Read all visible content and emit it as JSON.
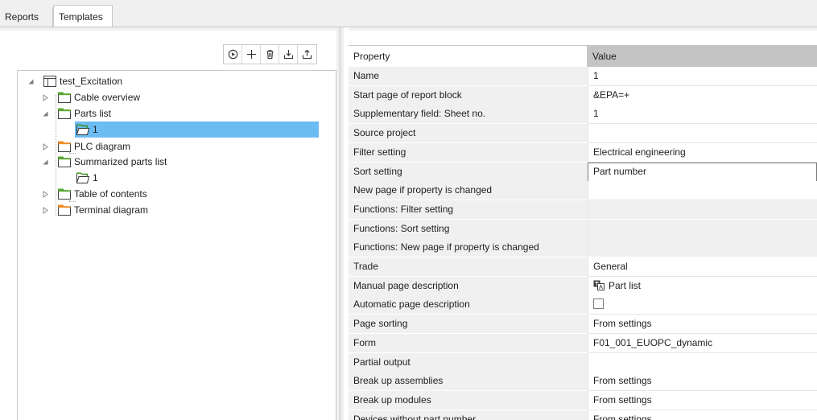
{
  "tabs": [
    {
      "label": "Reports",
      "active": false
    },
    {
      "label": "Templates",
      "active": true
    }
  ],
  "toolbar": {
    "icons": [
      "play-icon",
      "add-icon",
      "delete-icon",
      "import-icon",
      "export-icon"
    ]
  },
  "tree": {
    "items": [
      {
        "label": "test_Excitation",
        "level": 0,
        "expanded": true,
        "icon": "template-root-icon"
      },
      {
        "label": "Cable overview",
        "level": 1,
        "expanded": false,
        "icon": "folder-icon",
        "folder_color": "#5aa832"
      },
      {
        "label": "Parts list",
        "level": 1,
        "expanded": true,
        "icon": "folder-icon",
        "folder_color": "#5aa832"
      },
      {
        "label": "1",
        "level": 2,
        "selected": true,
        "icon": "folder-icon",
        "folder_color": "#5aa832"
      },
      {
        "label": "PLC diagram",
        "level": 1,
        "expanded": false,
        "icon": "folder-icon",
        "folder_color": "#f08c28"
      },
      {
        "label": "Summarized parts list",
        "level": 1,
        "expanded": true,
        "icon": "folder-icon",
        "folder_color": "#5aa832"
      },
      {
        "label": "1",
        "level": 2,
        "icon": "folder-icon",
        "folder_color": "#5aa832"
      },
      {
        "label": "Table of contents",
        "level": 1,
        "expanded": false,
        "icon": "folder-icon",
        "folder_color": "#5aa832"
      },
      {
        "label": "Terminal diagram",
        "level": 1,
        "expanded": false,
        "icon": "folder-icon",
        "folder_color": "#f08c28"
      }
    ]
  },
  "grid": {
    "header": {
      "property": "Property",
      "value": "Value"
    },
    "rows": [
      {
        "property": "Name",
        "value": "1"
      },
      {
        "property": "Start page of report block",
        "value": "&EPA=+"
      },
      {
        "property": "Supplementary field: Sheet no.",
        "value": "1"
      },
      {
        "property": "Source project",
        "value": ""
      },
      {
        "property": "Filter setting",
        "value": "Electrical engineering"
      },
      {
        "property": "Sort setting",
        "value": "Part number",
        "editing": true
      },
      {
        "property": "New page if property is changed",
        "value": ""
      },
      {
        "property": "Functions: Filter setting",
        "value": "",
        "readonly": true
      },
      {
        "property": "Functions: Sort setting",
        "value": "",
        "readonly": true
      },
      {
        "property": "Functions: New page if property is changed",
        "value": "",
        "readonly": true
      },
      {
        "property": "Trade",
        "value": "General"
      },
      {
        "property": "Manual page description",
        "value": "Part list",
        "icon": "translate-icon"
      },
      {
        "property": "Automatic page description",
        "value": "",
        "checkbox": true,
        "checked": false
      },
      {
        "property": "Page sorting",
        "value": "From settings"
      },
      {
        "property": "Form",
        "value": "F01_001_EUOPC_dynamic"
      },
      {
        "property": "Partial output",
        "value": ""
      },
      {
        "property": "Break up assemblies",
        "value": "From settings"
      },
      {
        "property": "Break up modules",
        "value": "From settings"
      },
      {
        "property": "Devices without part number",
        "value": "From settings"
      }
    ]
  },
  "colors": {
    "selection": "#6cbcf4",
    "folder_green": "#5aa832",
    "folder_orange": "#f08c28",
    "header_value_bg": "#c4c4c4",
    "property_bg": "#f0f0f0"
  }
}
